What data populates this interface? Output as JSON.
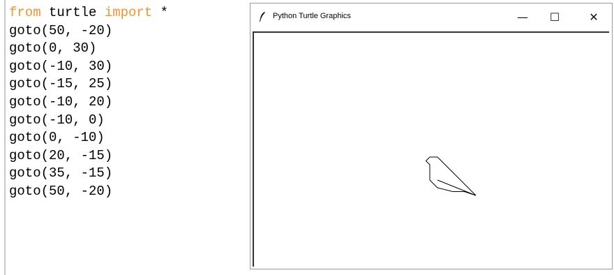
{
  "editor": {
    "lines": [
      [
        {
          "t": "from",
          "kw": true
        },
        {
          "t": " turtle ",
          "kw": false
        },
        {
          "t": "import",
          "kw": true
        },
        {
          "t": " *",
          "kw": false
        }
      ],
      [
        {
          "t": "goto(50, -20)",
          "kw": false
        }
      ],
      [
        {
          "t": "goto(0, 30)",
          "kw": false
        }
      ],
      [
        {
          "t": "goto(-10, 30)",
          "kw": false
        }
      ],
      [
        {
          "t": "goto(-15, 25)",
          "kw": false
        }
      ],
      [
        {
          "t": "goto(-10, 20)",
          "kw": false
        }
      ],
      [
        {
          "t": "goto(-10, 0)",
          "kw": false
        }
      ],
      [
        {
          "t": "goto(0, -10)",
          "kw": false
        }
      ],
      [
        {
          "t": "goto(20, -15)",
          "kw": false
        }
      ],
      [
        {
          "t": "goto(35, -15)",
          "kw": false
        }
      ],
      [
        {
          "t": "goto(50, -20)",
          "kw": false
        }
      ]
    ],
    "keyword_color": "#f59331"
  },
  "window": {
    "title": "Python Turtle Graphics",
    "icon": "feather-icon",
    "controls": {
      "minimize": "—",
      "maximize": "☐",
      "close": "✕"
    }
  },
  "turtle_path": [
    [
      0,
      0
    ],
    [
      50,
      -20
    ],
    [
      0,
      30
    ],
    [
      -10,
      30
    ],
    [
      -15,
      25
    ],
    [
      -10,
      20
    ],
    [
      -10,
      0
    ],
    [
      0,
      -10
    ],
    [
      20,
      -15
    ],
    [
      35,
      -15
    ],
    [
      50,
      -20
    ]
  ],
  "stroke_color": "#000000"
}
